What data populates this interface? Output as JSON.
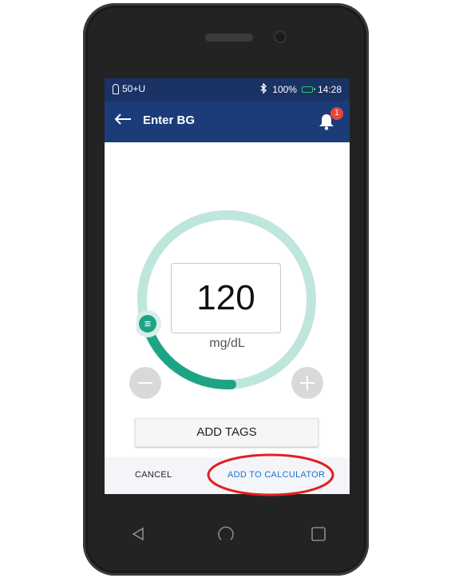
{
  "status_bar": {
    "pod_text": "50+U",
    "battery": "100%",
    "time": "14:28"
  },
  "header": {
    "title": "Enter BG",
    "notification_count": "1"
  },
  "reading": {
    "value": "120",
    "unit": "mg/dL"
  },
  "buttons": {
    "add_tags": "ADD TAGS",
    "cancel": "CANCEL",
    "add_to_calculator": "ADD TO CALCULATOR"
  },
  "colors": {
    "status_bar": "#1a3264",
    "app_bar": "#1b3c79",
    "dial_track": "#bfe6dd",
    "dial_fill": "#1fa386",
    "badge": "#e8463b",
    "link": "#1f6fd6",
    "annotation": "#e0201f"
  },
  "icons": [
    "pod-icon",
    "bluetooth-icon",
    "battery-charging-icon",
    "back-arrow-icon",
    "bell-icon",
    "menu-handle-icon",
    "minus-icon",
    "plus-icon",
    "nav-back-icon",
    "nav-home-icon",
    "nav-recent-icon"
  ]
}
